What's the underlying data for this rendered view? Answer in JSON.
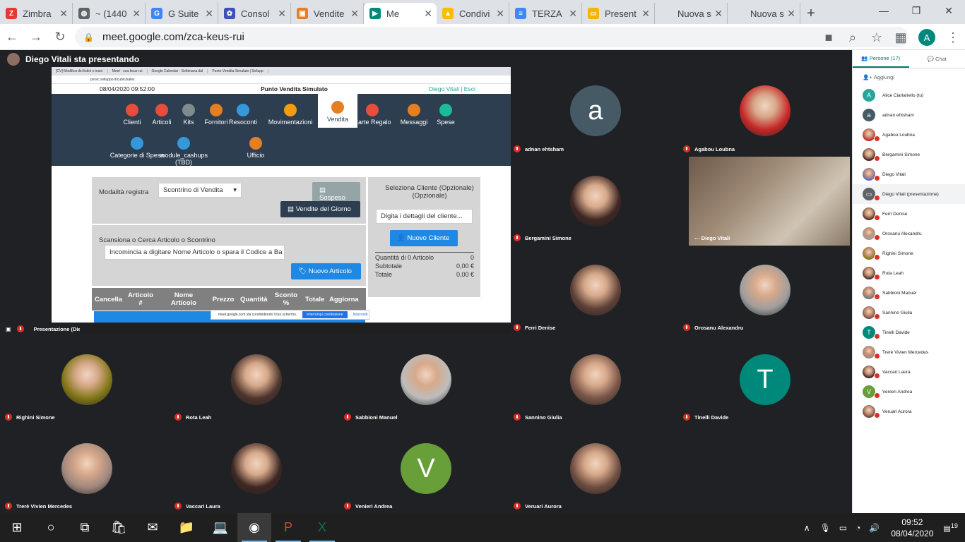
{
  "browser": {
    "tabs": [
      {
        "title": "Zimbra",
        "color": "#e53935",
        "glyph": "Z"
      },
      {
        "title": "~ (1440",
        "color": "#5f6368",
        "glyph": "◍"
      },
      {
        "title": "G Suite",
        "color": "#4285f4",
        "glyph": "G"
      },
      {
        "title": "Consol",
        "color": "#3f51b5",
        "glyph": "✿"
      },
      {
        "title": "Vendite",
        "color": "#e67e22",
        "glyph": "▣"
      },
      {
        "title": "Me",
        "color": "#00897b",
        "glyph": "▶",
        "active": true
      },
      {
        "title": "Condivi",
        "color": "#fbbc04",
        "glyph": "▲"
      },
      {
        "title": "TERZA",
        "color": "#4285f4",
        "glyph": "≡"
      },
      {
        "title": "Present",
        "color": "#f4b400",
        "glyph": "▭"
      },
      {
        "title": "Nuova sche",
        "color": "#dee1e6",
        "glyph": ""
      },
      {
        "title": "Nuova sche",
        "color": "#dee1e6",
        "glyph": ""
      }
    ],
    "url": "meet.google.com/zca-keus-rui",
    "profile_initial": "A"
  },
  "meet": {
    "presenter_label": "Diego Vitali sta presentando",
    "presentation_label": "Presentazione (Diego Vitali)",
    "selfview_name": "Diego Vitali",
    "tiles": [
      {
        "name": "adnan ehtsham",
        "letter": "a",
        "color": "#455a64"
      },
      {
        "name": "Agabou Loubna",
        "photo": "#c62828"
      },
      {
        "name": "Bergamini Simone",
        "photo": "#3e2723"
      },
      {
        "name": "Ferri Denise",
        "photo": "#5d4037"
      },
      {
        "name": "Orosanu Alexandru",
        "photo": "#9e9e9e"
      },
      {
        "name": "Righini Simone",
        "photo": "#827717"
      },
      {
        "name": "Rota Leah",
        "photo": "#4e342e"
      },
      {
        "name": "Sabbioni Manuel",
        "photo": "#bdbdbd"
      },
      {
        "name": "Sannino Giulia",
        "photo": "#795548"
      },
      {
        "name": "Tinelli Davide",
        "letter": "T",
        "color": "#00897b"
      },
      {
        "name": "Trerè Vivien Mercedes",
        "photo": "#a1887f"
      },
      {
        "name": "Vaccari Laura",
        "photo": "#3e2723"
      },
      {
        "name": "Venieri Andrea",
        "letter": "V",
        "color": "#689f38"
      },
      {
        "name": "Veruari Aurora",
        "photo": "#6d4c41"
      }
    ]
  },
  "pos": {
    "mini_tabs": [
      "[CV] Modifica dei listini e inser",
      "Meet - zca-keus-rui",
      "Google Calendar - Settimana dal",
      "Punto Vendita Simulato | Svilupp"
    ],
    "mini_url": "pvsvc.sviluppo.it/cubic/sales",
    "datetime": "08/04/2020 09:52:00",
    "title": "Punto Vendita Simulato",
    "user": "Diego Vitali",
    "logout": "Esci",
    "nav": [
      {
        "label": "Clienti",
        "color": "#e74c3c"
      },
      {
        "label": "Articoli",
        "color": "#e74c3c"
      },
      {
        "label": "Kits",
        "color": "#7f8c8d"
      },
      {
        "label": "Fornitori",
        "color": "#e67e22"
      },
      {
        "label": "Resoconti",
        "color": "#3498db"
      },
      {
        "label": "Movimentazioni",
        "color": "#f39c12"
      },
      {
        "label": "Vendita",
        "color": "#e67e22"
      },
      {
        "label": "Carte Regalo",
        "color": "#e74c3c"
      },
      {
        "label": "Messaggi",
        "color": "#e67e22"
      },
      {
        "label": "Spese",
        "color": "#1abc9c"
      },
      {
        "label": "Categorie di Spesa",
        "color": "#3498db"
      },
      {
        "label": "module_cashups (TBD)",
        "color": "#3498db"
      },
      {
        "label": "Ufficio",
        "color": "#e67e22"
      }
    ],
    "mode_label": "Modalità registra",
    "mode_value": "Scontrino di Vendita",
    "suspend": "Sospeso",
    "daily_sales": "Vendite del Giorno",
    "search_label": "Scansiona o Cerca Articolo o Scontrino",
    "search_placeholder": "Incomincia a digitare Nome Articolo o spara il Codice a Ba",
    "new_item": "Nuovo Articolo",
    "columns": [
      "Cancella",
      "Articolo #",
      "Nome Articolo",
      "Prezzo",
      "Quantità",
      "Sconto %",
      "Totale",
      "Aggiorna"
    ],
    "customer_label": "Seleziona Cliente (Opzionale) (Opzionale)",
    "customer_placeholder": "Digita i dettagli del cliente...",
    "new_customer": "Nuovo Cliente",
    "qty_label": "Quantità di 0 Articolo",
    "qty_value": "0",
    "subtotal_label": "Subtotale",
    "subtotal_value": "0,00 €",
    "total_label": "Totale",
    "total_value": "0,00 €",
    "share_msg": "meet.google.com sta condividendo il tuo schermo.",
    "share_stop": "Interrompi condivisione",
    "share_hide": "Nascondi"
  },
  "sidebar": {
    "tab_people": "Persone (17)",
    "tab_chat": "Chat",
    "add": "Aggiungi",
    "people": [
      {
        "name": "Alice Ciarlariello (tu)",
        "initial": "A",
        "color": "#26a69a"
      },
      {
        "name": "adnan ehtsham",
        "initial": "a",
        "color": "#455a64"
      },
      {
        "name": "Agabou Loubna",
        "initial": "",
        "color": "#c62828"
      },
      {
        "name": "Bergamini Simone",
        "initial": "",
        "color": "#3e2723"
      },
      {
        "name": "Diego Vitali",
        "initial": "",
        "color": "#5c6bc0"
      },
      {
        "name": "Diego Vitali (presentazione)",
        "initial": "▭",
        "color": "#5f6368"
      },
      {
        "name": "Ferri Denise",
        "initial": "",
        "color": "#4e342e"
      },
      {
        "name": "Orosanu Alexandru",
        "initial": "",
        "color": "#9e9e9e"
      },
      {
        "name": "Righini Simone",
        "initial": "",
        "color": "#827717"
      },
      {
        "name": "Rota Leah",
        "initial": "",
        "color": "#4e342e"
      },
      {
        "name": "Sabbioni Manuel",
        "initial": "",
        "color": "#757575"
      },
      {
        "name": "Sannino Giulia",
        "initial": "",
        "color": "#795548"
      },
      {
        "name": "Tinelli Davide",
        "initial": "T",
        "color": "#00897b"
      },
      {
        "name": "Trerè Vivien Mercedes",
        "initial": "",
        "color": "#a1887f"
      },
      {
        "name": "Vaccari Laura",
        "initial": "",
        "color": "#3e2723"
      },
      {
        "name": "Venieri Andrea",
        "initial": "V",
        "color": "#689f38"
      },
      {
        "name": "Veruari Aurora",
        "initial": "",
        "color": "#6d4c41"
      }
    ]
  },
  "taskbar": {
    "time": "09:52",
    "date": "08/04/2020",
    "notifications": "19"
  }
}
